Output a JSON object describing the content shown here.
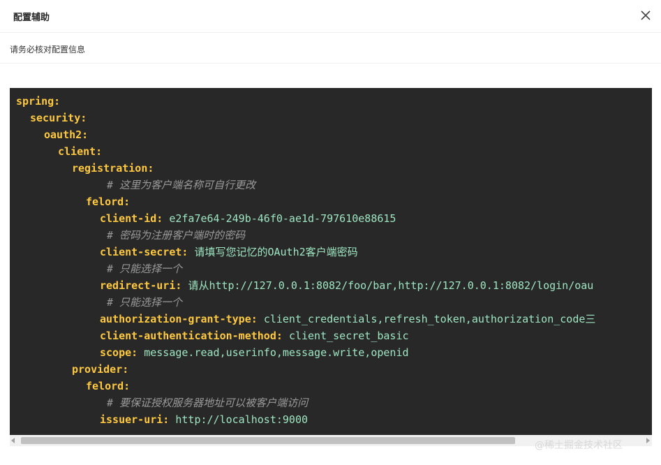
{
  "dialog": {
    "title": "配置辅助",
    "subtitle": "请务必核对配置信息",
    "close_icon": "close-icon"
  },
  "code": {
    "lines": [
      {
        "key": "spring:",
        "value": "",
        "comment": ""
      },
      {
        "key": "security:",
        "value": "",
        "comment": ""
      },
      {
        "key": "oauth2:",
        "value": "",
        "comment": ""
      },
      {
        "key": "client:",
        "value": "",
        "comment": ""
      },
      {
        "key": "registration:",
        "value": "",
        "comment": ""
      },
      {
        "key": "",
        "value": "",
        "comment": "# 这里为客户端名称可自行更改"
      },
      {
        "key": "felord:",
        "value": "",
        "comment": ""
      },
      {
        "key": "client-id:",
        "value": "e2fa7e64-249b-46f0-ae1d-797610e88615",
        "comment": ""
      },
      {
        "key": "",
        "value": "",
        "comment": "# 密码为注册客户端时的密码"
      },
      {
        "key": "client-secret:",
        "value": "请填写您记忆的OAuth2客户端密码",
        "comment": ""
      },
      {
        "key": "",
        "value": "",
        "comment": "# 只能选择一个"
      },
      {
        "key": "redirect-uri:",
        "value": "请从http://127.0.0.1:8082/foo/bar,http://127.0.0.1:8082/login/oau",
        "comment": ""
      },
      {
        "key": "",
        "value": "",
        "comment": "# 只能选择一个"
      },
      {
        "key": "authorization-grant-type:",
        "value": "client_credentials,refresh_token,authorization_code三",
        "comment": ""
      },
      {
        "key": "client-authentication-method:",
        "value": "client_secret_basic",
        "comment": ""
      },
      {
        "key": "scope:",
        "value": "message.read,userinfo,message.write,openid",
        "comment": ""
      },
      {
        "key": "provider:",
        "value": "",
        "comment": ""
      },
      {
        "key": "felord:",
        "value": "",
        "comment": ""
      },
      {
        "key": "",
        "value": "",
        "comment": "# 要保证授权服务器地址可以被客户端访问"
      },
      {
        "key": "issuer-uri:",
        "value": "http://localhost:9000",
        "comment": ""
      }
    ]
  },
  "watermark": "@稀土掘金技术社区",
  "colors": {
    "code_bg": "#282828",
    "key": "#ffc940",
    "value": "#9ee6c2",
    "comment": "#9a9a9a"
  }
}
